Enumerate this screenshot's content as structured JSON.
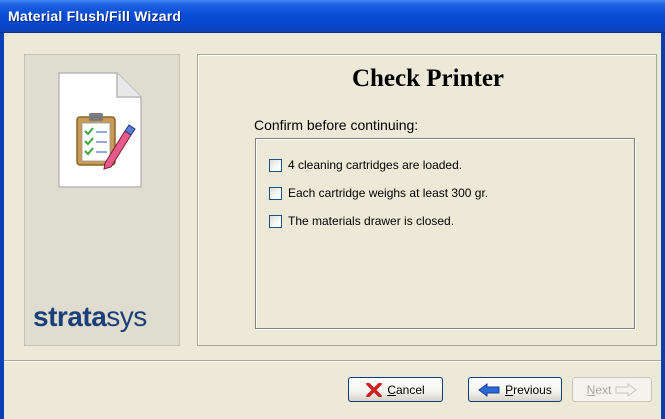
{
  "window": {
    "title": "Material Flush/Fill Wizard",
    "accent_color": "#0a4fd8"
  },
  "left_panel": {
    "icon_name": "clipboard-checklist-icon",
    "logo_text_bold": "strata",
    "logo_text_thin": "sys"
  },
  "main": {
    "page_title": "Check Printer",
    "confirm_label": "Confirm before continuing:",
    "checklist": [
      {
        "label": "4 cleaning cartridges are loaded.",
        "checked": false
      },
      {
        "label": "Each cartridge weighs at least 300 gr.",
        "checked": false
      },
      {
        "label": "The materials drawer is closed.",
        "checked": false
      }
    ]
  },
  "buttons": {
    "cancel": {
      "label_u": "C",
      "label_rest": "ancel",
      "enabled": true,
      "icon": "x-icon"
    },
    "previous": {
      "label_u": "P",
      "label_rest": "revious",
      "enabled": true,
      "icon": "arrow-left-icon"
    },
    "next": {
      "label_u": "N",
      "label_rest": "ext",
      "enabled": false,
      "icon": "arrow-right-icon"
    }
  }
}
